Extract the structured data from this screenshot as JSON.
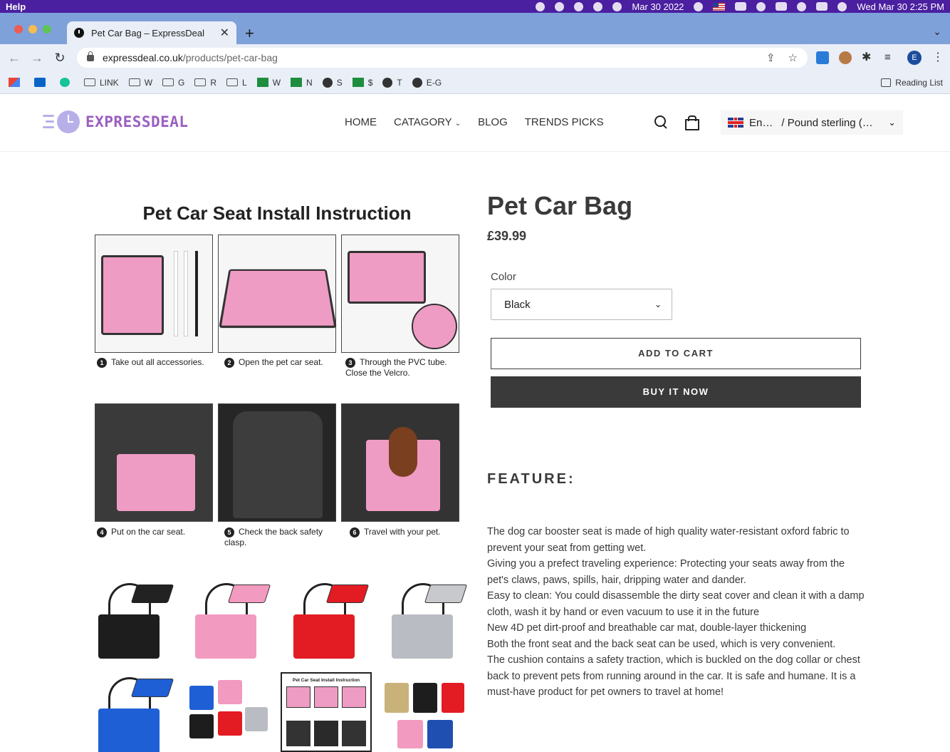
{
  "menubar": {
    "app_menu": "Help",
    "date": "Mar 30 2022",
    "clock": "Wed Mar 30  2:25 PM"
  },
  "browser": {
    "tab_title": "Pet Car Bag – ExpressDeal",
    "url_host": "expressdeal.co.uk",
    "url_path": "/products/pet-car-bag",
    "profile_initial": "E",
    "bookmarks": [
      "LINK",
      "W",
      "G",
      "R",
      "L",
      "W",
      "N",
      "S",
      "$",
      "T",
      "E-G"
    ],
    "reading_list": "Reading List"
  },
  "site": {
    "logo_text": "EXPRESSDEAL",
    "nav": [
      "HOME",
      "CATAGORY",
      "BLOG",
      "TRENDS PICKS"
    ],
    "language": "En…",
    "currency": "/ Pound sterling (…"
  },
  "product": {
    "title": "Pet Car Bag",
    "price": "£39.99",
    "option_label": "Color",
    "option_value": "Black",
    "add_to_cart": "ADD TO CART",
    "buy_now": "BUY IT NOW",
    "feature_heading": "FEATURE:",
    "description": [
      "The dog car booster seat is made of high quality water-resistant oxford fabric to prevent your seat from getting wet.",
      "Giving you a prefect traveling experience: Protecting your seats away from the pet's claws, paws, spills, hair, dripping water and dander.",
      "Easy to clean: You could disassemble the dirty seat cover and clean it with a damp cloth, wash it by hand or even vacuum to use it in the future",
      "New 4D pet dirt-proof and breathable car mat, double-layer thickening",
      "Both the front seat and the back seat can be used, which is very convenient.",
      "The cushion contains a safety traction, which is buckled on the dog collar or chest back to prevent pets from running around in the car. It is safe and humane. It is a must-have product for pet owners to travel at home!"
    ],
    "image": {
      "title": "Pet Car Seat Install Instruction",
      "steps": [
        {
          "n": "1",
          "text": "Take out all accessories."
        },
        {
          "n": "2",
          "text": "Open the pet car seat."
        },
        {
          "n": "3",
          "text": "Through the PVC tube. Close the Velcro."
        },
        {
          "n": "4",
          "text": "Put on the car seat."
        },
        {
          "n": "5",
          "text": "Check the back safety clasp."
        },
        {
          "n": "6",
          "text": "Travel with your pet."
        }
      ]
    },
    "thumbnails": [
      {
        "color": "#1d1d1d"
      },
      {
        "color": "#f29ac0"
      },
      {
        "color": "#e31b23"
      },
      {
        "color": "#b9bcc2"
      },
      {
        "color": "#1f5fd6"
      },
      {
        "color": "#mixed"
      },
      {
        "color": "#instruction"
      },
      {
        "color": "#dogs"
      }
    ]
  }
}
